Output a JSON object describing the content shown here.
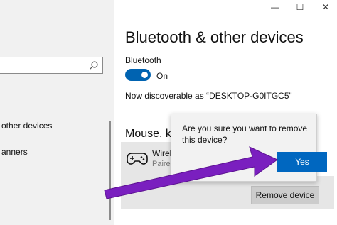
{
  "window": {
    "minimize_glyph": "—",
    "maximize_glyph": "☐",
    "close_glyph": "✕"
  },
  "sidebar": {
    "search": {
      "placeholder": "",
      "icon": "search-icon"
    },
    "items": [
      {
        "label": "other devices"
      },
      {
        "label": "anners"
      }
    ]
  },
  "main": {
    "title": "Bluetooth & other devices",
    "bluetooth": {
      "label": "Bluetooth",
      "toggle_on": true,
      "state_text": "On"
    },
    "discoverable_text": "Now discoverable as “DESKTOP-G0ITGC5”",
    "section_heading": "Mouse, k",
    "device": {
      "name": "Wirel",
      "status": "Paire",
      "icon": "gamepad-icon"
    },
    "remove_label": "Remove device"
  },
  "dialog": {
    "message": "Are you sure you want to remove this device?",
    "yes_label": "Yes"
  },
  "colors": {
    "accent": "#0063b1",
    "arrow": "#7a1fbf",
    "sidebar_bg": "#f1f1f1"
  }
}
